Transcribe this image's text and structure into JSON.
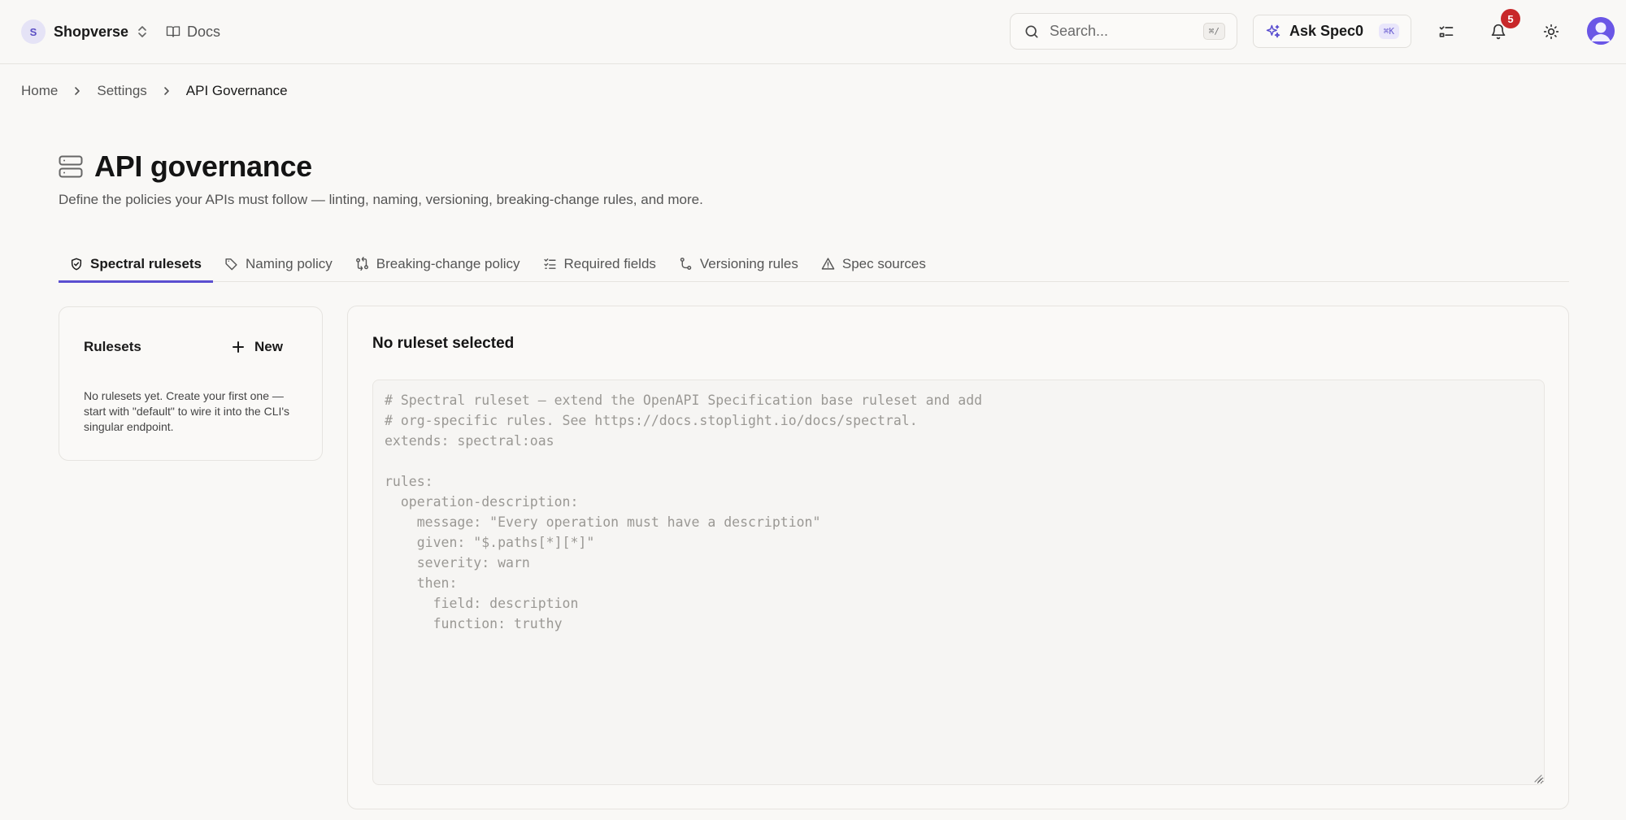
{
  "topbar": {
    "org_initial": "S",
    "org_name": "Shopverse",
    "docs_label": "Docs",
    "search_placeholder": "Search...",
    "search_shortcut": "⌘/",
    "ask_label": "Ask Spec0",
    "ask_shortcut": "⌘K",
    "notifications_count": "5"
  },
  "breadcrumb": {
    "items": [
      "Home",
      "Settings",
      "API Governance"
    ]
  },
  "page": {
    "title": "API governance",
    "description": "Define the policies your APIs must follow — linting, naming, versioning, breaking-change rules, and more."
  },
  "tabs": [
    {
      "label": "Spectral rulesets",
      "icon": "shield-check-icon",
      "active": true
    },
    {
      "label": "Naming policy",
      "icon": "tag-icon",
      "active": false
    },
    {
      "label": "Breaking-change policy",
      "icon": "git-compare-icon",
      "active": false
    },
    {
      "label": "Required fields",
      "icon": "checklist-icon",
      "active": false
    },
    {
      "label": "Versioning rules",
      "icon": "git-branch-icon",
      "active": false
    },
    {
      "label": "Spec sources",
      "icon": "warning-icon",
      "active": false
    }
  ],
  "rulesets": {
    "title": "Rulesets",
    "new_label": "New",
    "empty_text": "No rulesets yet. Create your first one — start with \"default\" to wire it into the CLI's singular endpoint."
  },
  "editor": {
    "title": "No ruleset selected",
    "placeholder": "# Spectral ruleset — extend the OpenAPI Specification base ruleset and add\n# org-specific rules. See https://docs.stoplight.io/docs/spectral.\nextends: spectral:oas\n\nrules:\n  operation-description:\n    message: \"Every operation must have a description\"\n    given: \"$.paths[*][*]\"\n    severity: warn\n    then:\n      field: description\n      function: truthy",
    "value": ""
  },
  "colors": {
    "accent": "#5b4fd0",
    "badge": "#c8282a",
    "background": "#f9f8f6"
  }
}
